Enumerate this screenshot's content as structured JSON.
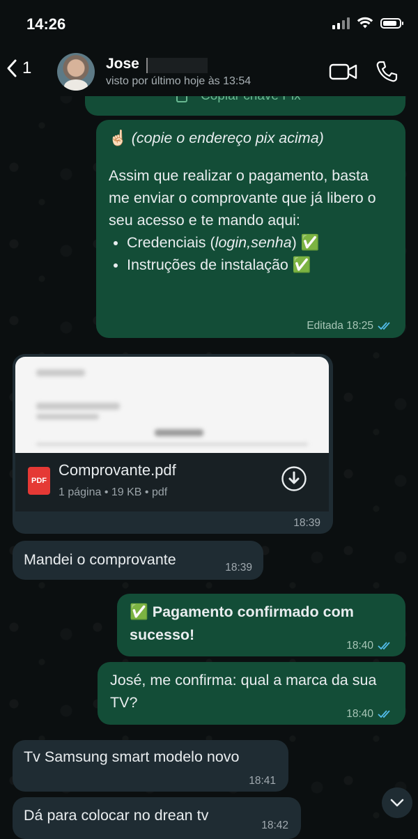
{
  "status": {
    "time": "14:26"
  },
  "header": {
    "back_count": "1",
    "name": "Jose",
    "last_seen": "visto por último hoje às 13:54"
  },
  "messages": {
    "partial_button": "Copiar chave Pix",
    "pix_note": "(copie o endereço pix acima)",
    "pix_emoji": "☝🏻",
    "payment_body": "Assim que realizar o pagamento, basta me enviar o comprovante que já libero o seu acesso e te mando aqui:",
    "bullet1_prefix": "Credenciais (",
    "bullet1_italic": "login,senha",
    "bullet1_suffix": ") ✅",
    "bullet2": "Instruções de instalação ✅",
    "edited_meta": "Editada 18:25",
    "pdf_name": "Comprovante.pdf",
    "pdf_info": "1 página • 19 KB • pdf",
    "pdf_label": "PDF",
    "pdf_time": "18:39",
    "sent_proof": "Mandei o comprovante",
    "sent_proof_time": "18:39",
    "confirmed": "✅ Pagamento confirmado com sucesso!",
    "confirmed_time": "18:40",
    "ask_brand": "José, me confirma: qual a marca da sua TV?",
    "ask_brand_time": "18:40",
    "tv_reply": "Tv Samsung smart modelo novo",
    "tv_reply_time": "18:41",
    "dream_tv": "Dá para colocar no drean tv",
    "dream_tv_time": "18:42"
  },
  "colors": {
    "outgoing_bubble": "#134d37",
    "incoming_bubble": "#1f2c33",
    "read_ticks": "#53bdeb",
    "background": "#0b0f10"
  }
}
